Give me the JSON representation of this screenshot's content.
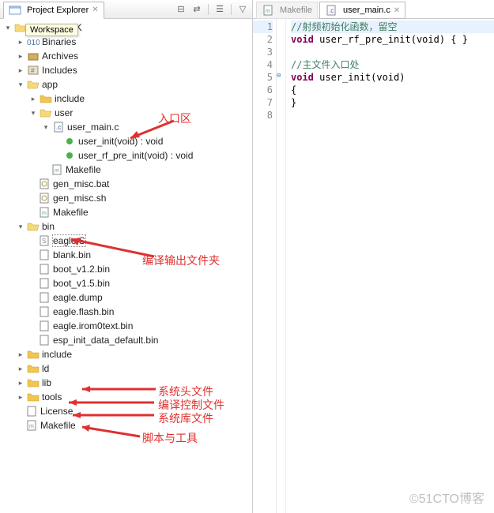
{
  "project_explorer": {
    "title": "Project Explorer",
    "tooltip": "Workspace",
    "tree": {
      "root": "ONOS_SDK",
      "binaries": "Binaries",
      "archives": "Archives",
      "includes_top": "Includes",
      "app": "app",
      "app_include": "include",
      "app_user": "user",
      "user_main_c": "user_main.c",
      "user_init_sig": "user_init(void) : void",
      "user_rf_pre_init_sig": "user_rf_pre_init(void) : void",
      "app_makefile": "Makefile",
      "gen_misc_bat": "gen_misc.bat",
      "gen_misc_sh": "gen_misc.sh",
      "makefile2": "Makefile",
      "bin": "bin",
      "eagle_s": "eagle.S",
      "blank_bin": "blank.bin",
      "boot_v12": "boot_v1.2.bin",
      "boot_v15": "boot_v1.5.bin",
      "eagle_dump": "eagle.dump",
      "eagle_flash": "eagle.flash.bin",
      "eagle_irom": "eagle.irom0text.bin",
      "esp_init": "esp_init_data_default.bin",
      "include": "include",
      "ld": "ld",
      "lib": "lib",
      "tools": "tools",
      "license": "License",
      "makefile3": "Makefile"
    }
  },
  "editor": {
    "tabs": {
      "makefile": "Makefile",
      "user_main_c": "user_main.c"
    },
    "code": {
      "l1_cmt": "//射频初始化函数，留空",
      "l2_kw": "void",
      "l2_fn": "user_rf_pre_init",
      "l2_params": "(void) { }",
      "l4_cmt": "//主文件入口处",
      "l5_kw": "void",
      "l5_fn": "user_init",
      "l5_params": "(void)",
      "l6": "{",
      "l7": "}"
    },
    "line_numbers": [
      "1",
      "2",
      "3",
      "4",
      "5",
      "6",
      "7",
      "8"
    ]
  },
  "annotations": {
    "entry": "入口区",
    "bin_out": "编译输出文件夹",
    "sys_h": "系统头文件",
    "compile_ctrl": "编译控制文件",
    "sys_lib": "系统库文件",
    "scripts": "脚本与工具"
  },
  "watermark": "©51CTO博客"
}
